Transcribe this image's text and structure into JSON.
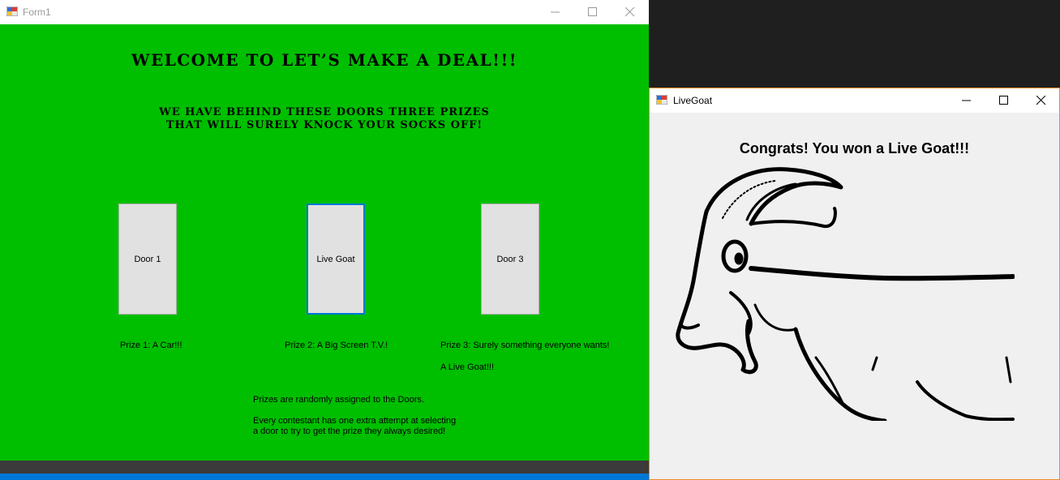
{
  "form1": {
    "title": "Form1",
    "heading": "WELCOME TO LET’S MAKE A DEAL!!!",
    "tagline_line1": "WE HAVE BEHIND THESE DOORS THREE PRIZES",
    "tagline_line2": "THAT WILL SURELY KNOCK YOUR SOCKS OFF!",
    "doors": [
      {
        "label": "Door 1"
      },
      {
        "label": "Live Goat"
      },
      {
        "label": "Door 3"
      }
    ],
    "prize_labels": [
      "Prize 1: A Car!!!",
      "Prize 2: A Big Screen T.V.!",
      "Prize 3: Surely something everyone wants!"
    ],
    "prize3_detail": "A Live Goat!!!",
    "info_line1": "Prizes are randomly assigned to the Doors.",
    "info_line2": "Every contestant has one extra attempt at selecting",
    "info_line3": "a door to try to get the prize they always desired!",
    "background_color": "#00bf00"
  },
  "livegoat": {
    "title": "LiveGoat",
    "message": "Congrats! You won a Live Goat!!!",
    "image": "goat-drawing"
  },
  "icons": {
    "app": "winforms-app-icon",
    "minimize": "minimize-icon",
    "maximize": "maximize-icon",
    "close": "close-icon"
  }
}
